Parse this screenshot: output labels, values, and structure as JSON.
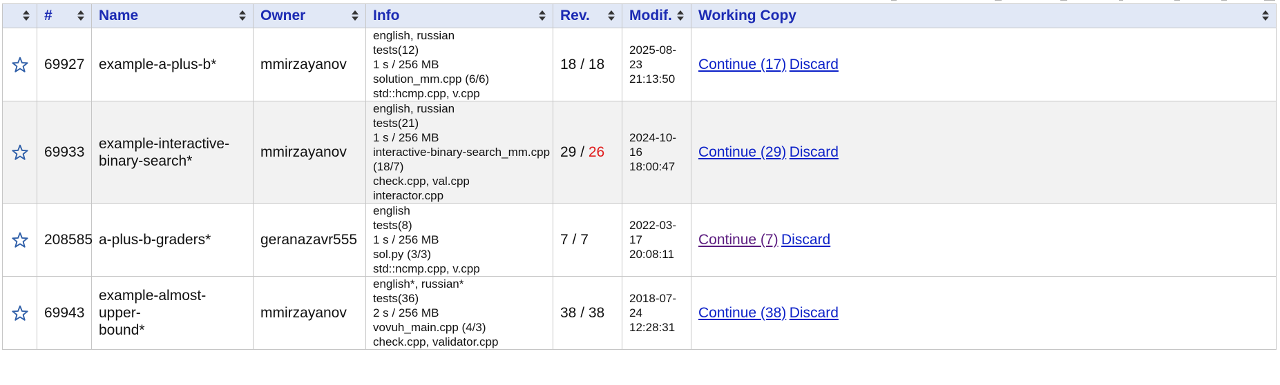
{
  "columns": {
    "star": "",
    "id": "#",
    "name": "Name",
    "owner": "Owner",
    "info": "Info",
    "rev": "Rev.",
    "modif": "Modif.",
    "working_copy": "Working Copy"
  },
  "rows": [
    {
      "id": "69927",
      "name_line1": "example-a-plus-b*",
      "name_line2": "",
      "owner": "mmirzayanov",
      "info": [
        "english, russian",
        "tests(12)",
        "1 s / 256 MB",
        "solution_mm.cpp (6/6)",
        "std::hcmp.cpp, v.cpp"
      ],
      "rev_current": "18",
      "rev_sep": " / ",
      "rev_latest": "18",
      "modif_date": "2025-08-23",
      "modif_time": "21:13:50",
      "continue_label": "Continue (17)",
      "discard_label": "Discard"
    },
    {
      "id": "69933",
      "name_line1": "example-interactive-",
      "name_line2": "binary-search*",
      "owner": "mmirzayanov",
      "info": [
        "english, russian",
        "tests(21)",
        "1 s / 256 MB",
        "interactive-binary-search_mm.cpp",
        "(18/7)",
        "check.cpp, val.cpp",
        "interactor.cpp"
      ],
      "rev_current": "29",
      "rev_sep": " / ",
      "rev_latest": "26",
      "modif_date": "2024-10-16",
      "modif_time": "18:00:47",
      "continue_label": "Continue (29)",
      "discard_label": "Discard"
    },
    {
      "id": "208585",
      "name_line1": "a-plus-b-graders*",
      "name_line2": "",
      "owner": "geranazavr555",
      "info": [
        "english",
        "tests(8)",
        "1 s / 256 MB",
        "sol.py (3/3)",
        "std::ncmp.cpp, v.cpp"
      ],
      "rev_current": "7",
      "rev_sep": " / ",
      "rev_latest": "7",
      "modif_date": "2022-03-17",
      "modif_time": "20:08:11",
      "continue_label": "Continue (7)",
      "discard_label": "Discard"
    },
    {
      "id": "69943",
      "name_line1": "example-almost-upper-",
      "name_line2": "bound*",
      "owner": "mmirzayanov",
      "info": [
        "english*, russian*",
        "tests(36)",
        "2 s / 256 MB",
        "vovuh_main.cpp (4/3)",
        "check.cpp, validator.cpp"
      ],
      "rev_current": "38",
      "rev_sep": " / ",
      "rev_latest": "38",
      "modif_date": "2018-07-24",
      "modif_time": "12:28:31",
      "continue_label": "Continue (38)",
      "discard_label": "Discard"
    }
  ],
  "colors": {
    "header_bg": "#e1e8f6",
    "header_text": "#1b2ab3",
    "link": "#0b20c8",
    "visited_link": "#5a1a7e",
    "revision_mismatch": "#e01b1b",
    "star_outline": "#2f5fa8",
    "alt_row_bg": "#f2f2f2"
  },
  "icons": {
    "favourite": "star-outline-icon",
    "sort": "sort-arrows-icon"
  }
}
